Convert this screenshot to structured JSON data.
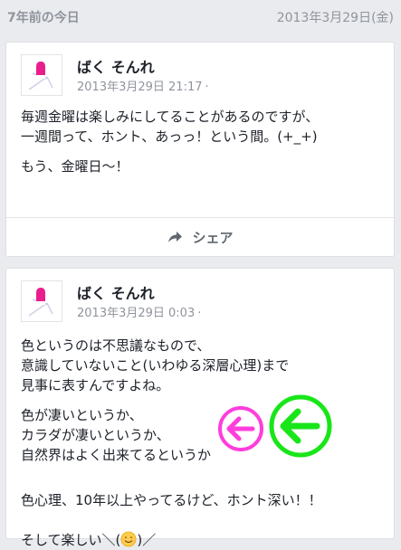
{
  "header": {
    "left": "7年前の今日",
    "right": "2013年3月29日(金)"
  },
  "posts": [
    {
      "author": "ばく そんれ",
      "timestamp": "2013年3月29日 21:17",
      "privacy_dot": "·",
      "paragraphs": [
        "毎週金曜は楽しみにしてることがあるのですが、\n一週間って、ホント、あっっ！という間。(+_+)",
        "もう、金曜日〜！"
      ],
      "share_label": "シェア"
    },
    {
      "author": "ばく そんれ",
      "timestamp": "2013年3月29日 0:03",
      "privacy_dot": "·",
      "paragraphs": [
        "色というのは不思議なもので、\n意識していないこと(いわゆる深層心理)まで\n見事に表すんですよね。",
        "色が凄いというか、\nカラダが凄いというか、\n自然界はよく出来てるというか",
        "色心理、10年以上やってるけど、ホント深い！！"
      ],
      "last_line_before_emoji": "そして楽しい＼(",
      "last_line_after_emoji": ")／"
    }
  ],
  "icons": {
    "share": "share-arrow-icon",
    "pink_arrow": "left-arrow-circle-icon",
    "green_arrow": "left-arrow-circle-icon",
    "emoji": "smiling-face-icon"
  },
  "colors": {
    "pink_arrow": "#ff3ddc",
    "green_arrow": "#19e619",
    "header_text": "#90949c",
    "body_text": "#1d2129"
  }
}
